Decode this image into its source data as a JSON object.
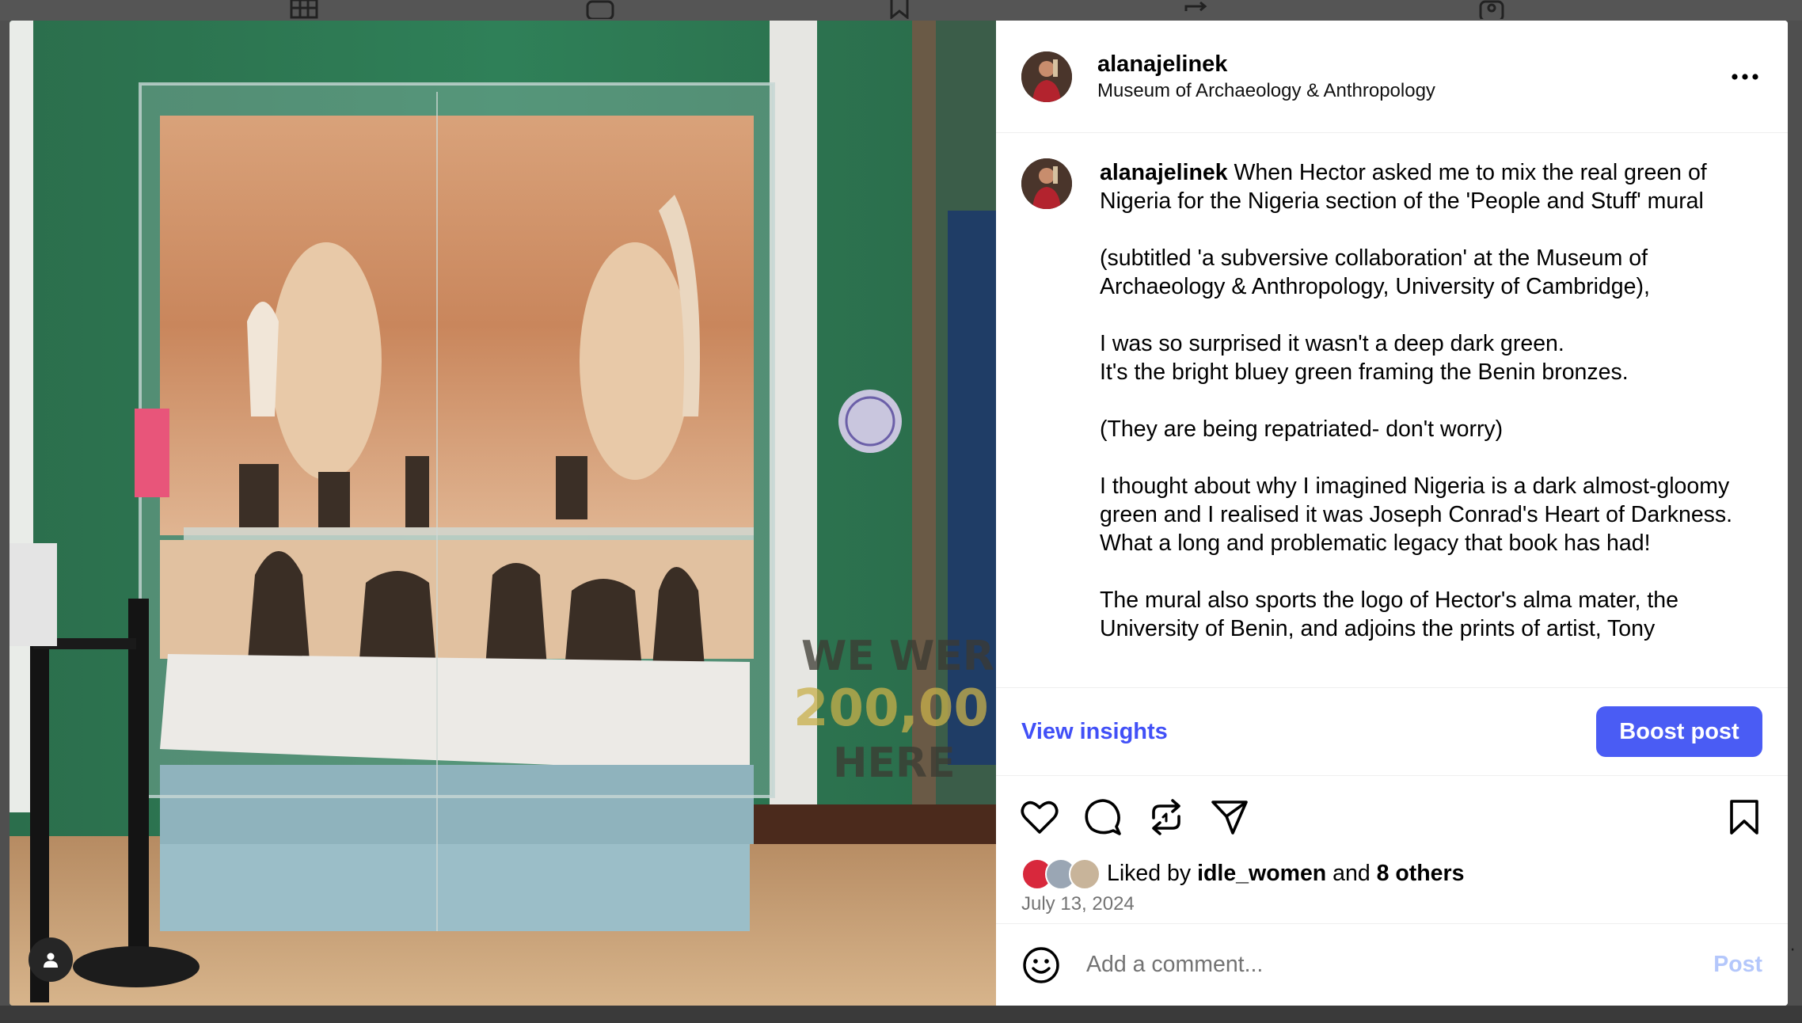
{
  "post": {
    "username": "alanajelinek",
    "location": "Museum of Archaeology & Anthropology",
    "more_label": "•••"
  },
  "caption": {
    "username": "alanajelinek",
    "paragraphs": [
      "When Hector asked me to mix the real green of Nigeria for the Nigeria section of the 'People and Stuff' mural",
      "(subtitled 'a subversive collaboration' at the Museum of Archaeology & Anthropology, University of Cambridge),",
      "I was so surprised it wasn't a deep dark green.\nIt's the bright bluey green framing the Benin bronzes.",
      "(They are being repatriated- don't worry)",
      "I thought about why I imagined Nigeria is a dark almost-gloomy green and I realised it was Joseph Conrad's Heart of Darkness.\nWhat a long and problematic legacy that book has had!",
      "The mural also sports the logo of Hector's alma mater, the University of Benin, and adjoins the prints of artist, Tony"
    ]
  },
  "insights": {
    "view_label": "View insights",
    "boost_label": "Boost post"
  },
  "likes": {
    "prefix": "Liked by",
    "top_liker": "idle_women",
    "conjunction": "and",
    "others": "8 others"
  },
  "date": "July 13, 2024",
  "comment": {
    "placeholder": "Add a comment...",
    "post_label": "Post"
  },
  "colors": {
    "accent_link": "#4150f7",
    "boost_bg": "#4a5cf4",
    "post_disabled": "#b4c7fb"
  },
  "icons": {
    "more": "more-options-icon",
    "like": "heart-icon",
    "comment": "comment-bubble-icon",
    "repost": "repost-icon",
    "share": "paper-plane-icon",
    "save": "bookmark-icon",
    "emoji": "emoji-icon",
    "tag": "user-tag-icon"
  },
  "photo": {
    "mural_text_lines": [
      "WE WERE",
      "200,00",
      "HERE"
    ]
  }
}
